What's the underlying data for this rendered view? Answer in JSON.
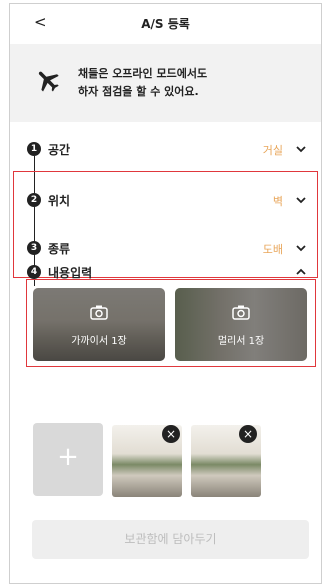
{
  "header": {
    "back_icon": "chevron-left-icon",
    "back_glyph": "<",
    "title": "A/S 등록"
  },
  "banner": {
    "icon": "airplane-icon",
    "line1": "채들은 오프라인 모드에서도",
    "line2": "하자 점검을 할 수 있어요."
  },
  "steps": [
    {
      "number": "1",
      "label": "공간",
      "value": "거실",
      "expanded": false
    },
    {
      "number": "2",
      "label": "위치",
      "value": "벽",
      "expanded": false
    },
    {
      "number": "3",
      "label": "종류",
      "value": "도배",
      "expanded": false
    },
    {
      "number": "4",
      "label": "내용입력",
      "value": "",
      "expanded": true
    }
  ],
  "photo_slots": [
    {
      "label": "가까이서 1장",
      "icon": "camera-icon"
    },
    {
      "label": "멀리서 1장",
      "icon": "camera-icon"
    }
  ],
  "add_photo": {
    "glyph": "+",
    "icon": "plus-icon"
  },
  "thumbnails": [
    {
      "delete_glyph": "×"
    },
    {
      "delete_glyph": "×"
    }
  ],
  "save_button": {
    "label": "보관함에 담아두기",
    "enabled": false
  },
  "colors": {
    "accent_value": "#e8a65a",
    "highlight_border": "#e0373c",
    "banner_bg": "#f2f2f2"
  }
}
